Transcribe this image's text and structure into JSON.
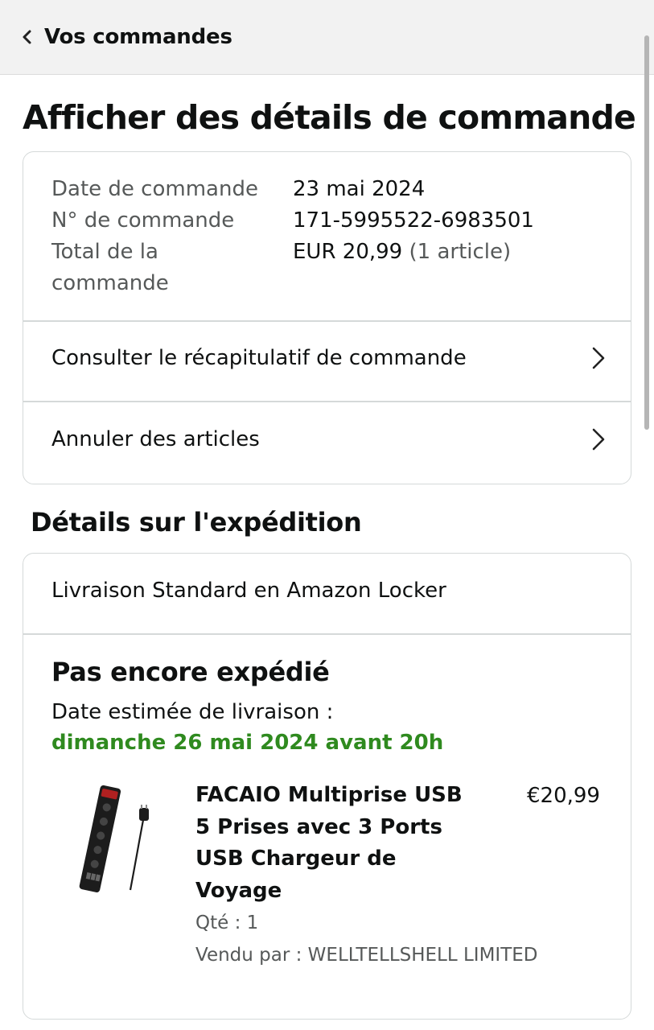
{
  "header": {
    "back_label": "Vos commandes"
  },
  "page_title": "Afficher des détails de commande",
  "order_info": {
    "date_label": "Date de commande",
    "date_value": "23 mai 2024",
    "number_label": "N° de commande",
    "number_value": "171-5995522-6983501",
    "total_label_line1": "Total de la",
    "total_label_line2": "commande",
    "total_value": "EUR 20,99",
    "total_count": "(1 article)"
  },
  "order_actions": [
    {
      "label": "Consulter le récapitulatif de commande",
      "icon": "chevron-right-icon"
    },
    {
      "label": "Annuler des articles",
      "icon": "chevron-right-icon"
    }
  ],
  "shipping": {
    "section_title": "Détails sur l'expédition",
    "method": "Livraison Standard en Amazon Locker",
    "status": "Pas encore expédié",
    "estimate_label": "Date estimée de livraison :",
    "estimate_date": "dimanche 26 mai 2024 avant 20h",
    "estimate_color": "#2f8a1f",
    "item": {
      "title": "FACAIO Multiprise USB 5 Prises avec 3 Ports USB Chargeur de Voyage",
      "price": "€20,99",
      "quantity": "Qté : 1",
      "seller": "Vendu par : WELLTELLSHELL LIMITED"
    }
  },
  "colors": {
    "header_bg": "#f2f2f2",
    "border": "#d5d9d9",
    "secondary_text": "#565959",
    "primary_text": "#0f1111"
  }
}
